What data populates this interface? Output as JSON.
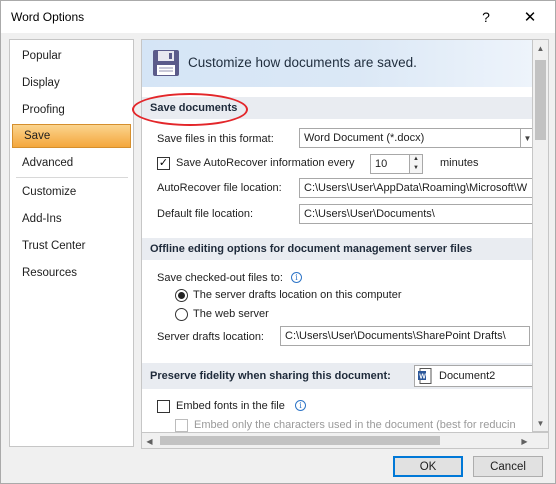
{
  "window": {
    "title": "Word Options",
    "help": "?",
    "close": "✕"
  },
  "nav": {
    "items": [
      {
        "label": "Popular"
      },
      {
        "label": "Display"
      },
      {
        "label": "Proofing"
      },
      {
        "label": "Save"
      },
      {
        "label": "Advanced"
      },
      {
        "label": "Customize"
      },
      {
        "label": "Add-Ins"
      },
      {
        "label": "Trust Center"
      },
      {
        "label": "Resources"
      }
    ],
    "selected": "Save"
  },
  "banner": {
    "text": "Customize how documents are saved.",
    "icon": "floppy-disk-icon"
  },
  "save_documents": {
    "header": "Save documents",
    "format_label": "Save files in this format:",
    "format_value": "Word Document (*.docx)",
    "autorecover_label": "Save AutoRecover information every",
    "autorecover_checked": true,
    "autorecover_minutes": "10",
    "minutes_label": "minutes",
    "autorecover_location_label": "AutoRecover file location:",
    "autorecover_location_value": "C:\\Users\\User\\AppData\\Roaming\\Microsoft\\W",
    "default_location_label": "Default file location:",
    "default_location_value": "C:\\Users\\User\\Documents\\"
  },
  "offline": {
    "header": "Offline editing options for document management server files",
    "checked_out_label": "Save checked-out files to:",
    "radio_server_drafts": "The server drafts location on this computer",
    "radio_web_server": "The web server",
    "server_drafts_label": "Server drafts location:",
    "server_drafts_value": "C:\\Users\\User\\Documents\\SharePoint Drafts\\"
  },
  "fidelity": {
    "header": "Preserve fidelity when sharing this document:",
    "document": "Document2",
    "embed_fonts_label": "Embed fonts in the file",
    "embed_only_label": "Embed only the characters used in the document (best for reducin"
  },
  "buttons": {
    "ok": "OK",
    "cancel": "Cancel"
  },
  "colors": {
    "accent_red": "#e3262a",
    "nav_selected": "#f4a73c",
    "button_focus": "#0078d7"
  }
}
